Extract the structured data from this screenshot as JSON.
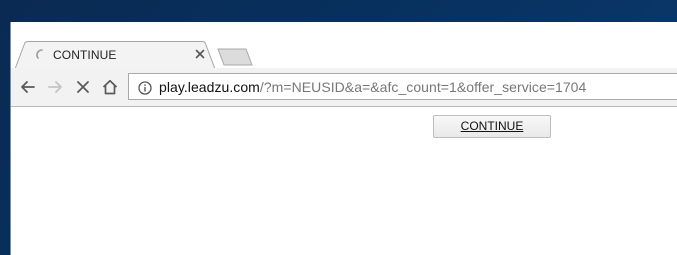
{
  "browser": {
    "tab": {
      "title": "CONTINUE",
      "loading_icon": "loading-spinner-icon",
      "close_icon": "close-icon"
    },
    "new_tab_icon": "new-tab-icon",
    "nav": {
      "back_icon": "back-arrow-icon",
      "forward_icon": "forward-arrow-icon",
      "stop_icon": "stop-icon",
      "home_icon": "home-icon"
    },
    "address_bar": {
      "info_icon": "info-icon",
      "host": "play.leadzu.com",
      "path": "/?m=NEUSID&a=&afc_count=1&offer_service=1704"
    }
  },
  "page": {
    "continue_button_label": "CONTINUE"
  },
  "colors": {
    "desktop_background": "#0a2a52",
    "tab_active": "#f3f3f3",
    "toolbar": "#f2f2f2",
    "url_host": "#111111",
    "url_path": "#777777"
  }
}
